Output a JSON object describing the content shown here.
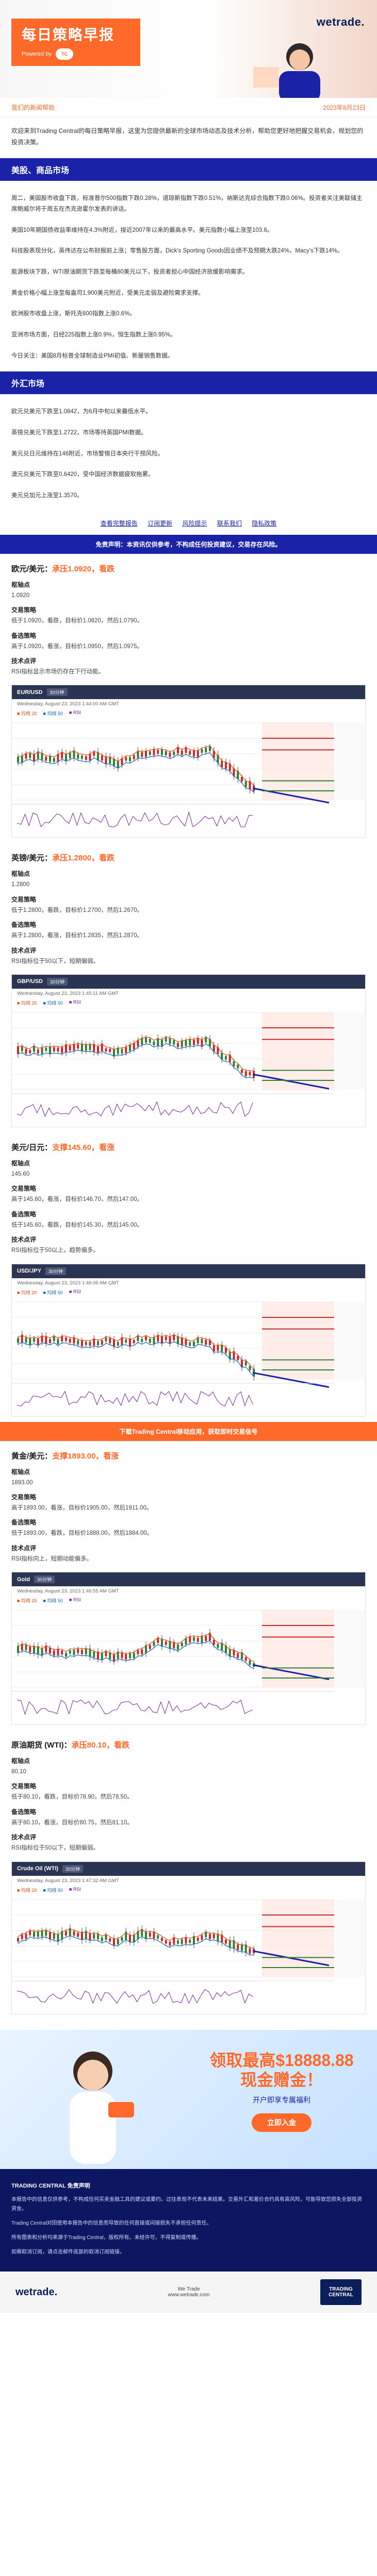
{
  "header": {
    "title": "每日策略早报",
    "powered_by": "Powered by",
    "partner_short": "TC",
    "brand": "wetrade."
  },
  "date_bar": {
    "left": "我们的新闻帮助",
    "right": "2023年8月23日"
  },
  "intro": "欢迎来到Trading Central的每日策略早报，这里为您提供最新的全球市场动态及技术分析，帮助您更好地把握交易机会，规划您的投资决策。",
  "section1": {
    "heading": "美股、商品市场",
    "paragraphs": [
      "周二，美国股市收盘下跌，标准普尔500指数下跌0.28%，道琼斯指数下跌0.51%，纳斯达克综合指数下跌0.06%。投资者关注美联储主席鲍威尔将于周五在杰克逊霍尔发表的讲话。",
      "美国10年期国债收益率维持在4.3%附近，接近2007年以来的最高水平。美元指数小幅上涨至103.6。",
      "科技股表现分化，英伟达在公布财报前上涨；零售股方面，Dick's Sporting Goods因业绩不及预期大跌24%，Macy's下跌14%。",
      "能源板块下跌，WTI原油期货下跌至每桶80美元以下，投资者担心中国经济放缓影响需求。",
      "黄金价格小幅上涨至每盎司1,900美元附近，受美元走弱及避险需求支撑。",
      "欧洲股市收盘上涨，斯托克600指数上涨0.6%。",
      "亚洲市场方面，日经225指数上涨0.9%，恒生指数上涨0.95%。",
      "今日关注：美国8月标普全球制造业PMI初值、新屋销售数据。"
    ]
  },
  "section2": {
    "heading": "外汇市场",
    "paragraphs": [
      "欧元兑美元下跌至1.0842，为6月中旬以来最低水平。",
      "英镑兑美元下跌至1.2722，市场等待英国PMI数据。",
      "美元兑日元维持在146附近，市场警惕日本央行干预风险。",
      "澳元兑美元下跌至0.6420，受中国经济数据疲软拖累。",
      "美元兑加元上涨至1.3570。"
    ]
  },
  "links": [
    "查看完整报告",
    "订阅更新",
    "风险提示",
    "联系我们",
    "隐私政策"
  ],
  "notice_blue": "免责声明：本资讯仅供参考，不构成任何投资建议，交易存在风险。",
  "notice_orange": "下载Trading Central移动应用，获取即时交易信号",
  "pairs": [
    {
      "name": "欧元/美元",
      "stance": "承压1.0920，看跌",
      "pivot_label": "枢轴点",
      "pivot": "1.0920",
      "strategy_label": "交易策略",
      "strategy": "低于1.0920，看跌，目标价1.0820，然后1.0790。",
      "alt_label": "备选策略",
      "alt": "高于1.0920，看涨，目标价1.0950，然后1.0975。",
      "tech_label": "技术点评",
      "tech": "RSI指标显示市场仍存在下行动能。",
      "chart_symbol": "EUR/USD",
      "chart_tag": "30分钟",
      "chart_time": "Wednesday, August 23, 2023 1:44:00 AM GMT",
      "chart_legend": [
        "均线 20",
        "均线 50",
        "RSI"
      ]
    },
    {
      "name": "英镑/美元",
      "stance": "承压1.2800，看跌",
      "pivot_label": "枢轴点",
      "pivot": "1.2800",
      "strategy_label": "交易策略",
      "strategy": "低于1.2800，看跌，目标价1.2700，然后1.2670。",
      "alt_label": "备选策略",
      "alt": "高于1.2800，看涨，目标价1.2835，然后1.2870。",
      "tech_label": "技术点评",
      "tech": "RSI指标位于50以下，短期偏弱。",
      "chart_symbol": "GBP/USD",
      "chart_tag": "30分钟",
      "chart_time": "Wednesday, August 23, 2023 1:45:11 AM GMT",
      "chart_legend": [
        "均线 20",
        "均线 50",
        "RSI"
      ]
    },
    {
      "name": "美元/日元",
      "stance": "支撑145.60，看涨",
      "pivot_label": "枢轴点",
      "pivot": "145.60",
      "strategy_label": "交易策略",
      "strategy": "高于145.60，看涨，目标价146.70，然后147.00。",
      "alt_label": "备选策略",
      "alt": "低于145.60，看跌，目标价145.30，然后145.00。",
      "tech_label": "技术点评",
      "tech": "RSI指标位于50以上，趋势偏多。",
      "chart_symbol": "USD/JPY",
      "chart_tag": "30分钟",
      "chart_time": "Wednesday, August 23, 2023 1:46:06 AM GMT",
      "chart_legend": [
        "均线 20",
        "均线 50",
        "RSI"
      ]
    },
    {
      "name": "黄金/美元",
      "stance": "支撑1893.00，看涨",
      "pivot_label": "枢轴点",
      "pivot": "1893.00",
      "strategy_label": "交易策略",
      "strategy": "高于1893.00，看涨，目标价1905.00，然后1911.00。",
      "alt_label": "备选策略",
      "alt": "低于1893.00，看跌，目标价1888.00，然后1884.00。",
      "tech_label": "技术点评",
      "tech": "RSI指标向上，短期动能偏多。",
      "chart_symbol": "Gold",
      "chart_tag": "30分钟",
      "chart_time": "Wednesday, August 23, 2023 1:46:55 AM GMT",
      "chart_legend": [
        "均线 20",
        "均线 50",
        "RSI"
      ]
    },
    {
      "name": "原油期货 (WTI)",
      "stance": "承压80.10，看跌",
      "pivot_label": "枢轴点",
      "pivot": "80.10",
      "strategy_label": "交易策略",
      "strategy": "低于80.10，看跌，目标价78.90，然后78.50。",
      "alt_label": "备选策略",
      "alt": "高于80.10，看涨，目标价80.75，然后81.10。",
      "tech_label": "技术点评",
      "tech": "RSI指标位于50以下，短期偏弱。",
      "chart_symbol": "Crude Oil (WTI)",
      "chart_tag": "30分钟",
      "chart_time": "Wednesday, August 23, 2023 1:47:32 AM GMT",
      "chart_legend": [
        "均线 20",
        "均线 50",
        "RSI"
      ]
    }
  ],
  "promo": {
    "big_line1": "领取最高$18888.88",
    "big_line2": "现金赠金！",
    "small": "开户即享专属福利",
    "button": "立即入金"
  },
  "disclaimer": {
    "heading": "TRADING CENTRAL 免责声明",
    "paragraphs": [
      "本报告中的信息仅供参考，不构成任何买卖金融工具的建议或要约。过往表现不代表未来结果。交易外汇和差价合约具有高风险，可能导致您损失全部投资资金。",
      "Trading Central对因使用本报告中的信息而导致的任何直接或间接损失不承担任何责任。",
      "所有图表和分析均来源于Trading Central，版权所有。未经许可，不得复制或传播。",
      "如需取消订阅，请点击邮件底部的取消订阅链接。"
    ]
  },
  "footer": {
    "brand": "wetrade.",
    "middle_line1": "We Trade",
    "middle_line2": "www.wetrade.com",
    "partner": "TRADING CENTRAL"
  },
  "colors": {
    "accent": "#ff6a2a",
    "navy": "#1a22a8",
    "dark": "#0d1660"
  }
}
